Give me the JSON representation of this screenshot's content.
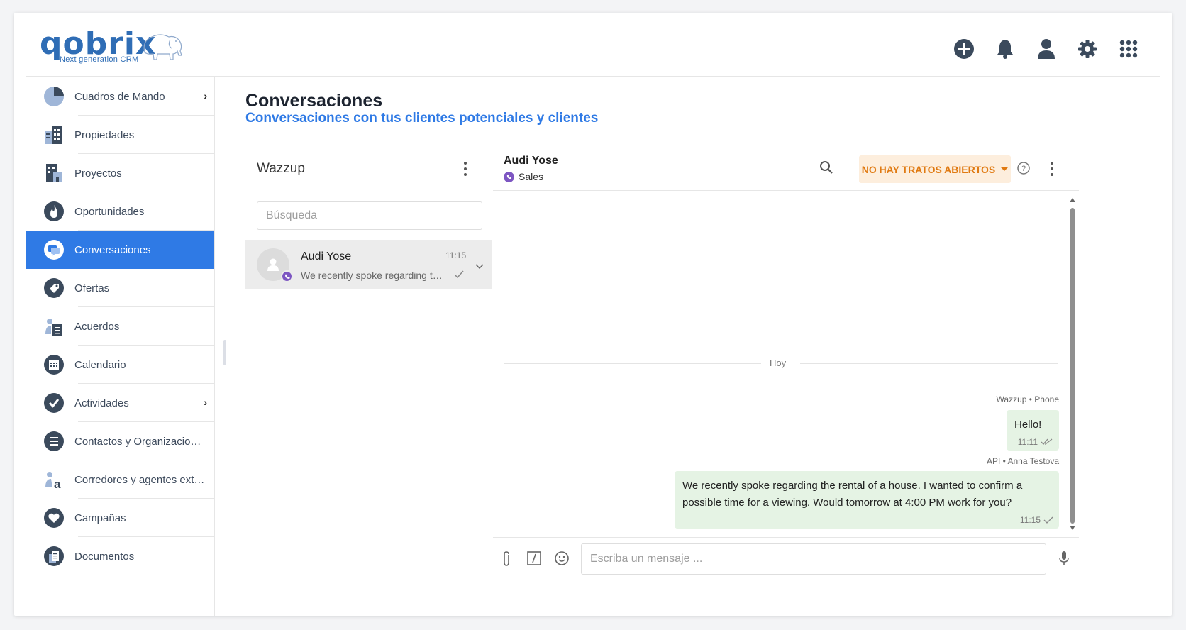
{
  "brand": {
    "name": "qobrix",
    "tagline": "Next generation CRM",
    "color": "#2f6db5"
  },
  "topbar": {
    "icons": [
      "add-circle-icon",
      "bell-icon",
      "user-icon",
      "gear-icon",
      "apps-grid-icon"
    ]
  },
  "sidebar": {
    "items": [
      {
        "label": "Cuadros de Mando",
        "icon": "pie-chart-icon",
        "has_submenu": true
      },
      {
        "label": "Propiedades",
        "icon": "building-icon"
      },
      {
        "label": "Proyectos",
        "icon": "project-building-icon"
      },
      {
        "label": "Oportunidades",
        "icon": "flame-icon"
      },
      {
        "label": "Conversaciones",
        "icon": "chat-icon",
        "active": true
      },
      {
        "label": "Ofertas",
        "icon": "tag-icon"
      },
      {
        "label": "Acuerdos",
        "icon": "agreement-icon"
      },
      {
        "label": "Calendario",
        "icon": "calendar-icon"
      },
      {
        "label": "Actividades",
        "icon": "check-circle-icon",
        "has_submenu": true
      },
      {
        "label": "Contactos y Organizaciones",
        "icon": "contacts-icon"
      },
      {
        "label": "Corredores y agentes exte…",
        "icon": "agents-icon"
      },
      {
        "label": "Campañas",
        "icon": "heart-icon"
      },
      {
        "label": "Documentos",
        "icon": "documents-icon"
      }
    ],
    "active_color": "#2f7ae5"
  },
  "page": {
    "title": "Conversaciones",
    "subtitle": "Conversaciones con tus clientes potenciales y clientes"
  },
  "conversation_list": {
    "title": "Wazzup",
    "search_placeholder": "Búsqueda",
    "items": [
      {
        "name": "Audi Yose",
        "time": "11:15",
        "preview": "We recently spoke regarding th…",
        "channel_icon": "viber-icon"
      }
    ]
  },
  "chat": {
    "contact_name": "Audi Yose",
    "channel": "Sales",
    "deals_button": "NO HAY TRATOS ABIERTOS",
    "day_separator": "Hoy",
    "messages": [
      {
        "meta": "Wazzup • Phone",
        "text": "Hello!",
        "time": "11:11",
        "status": "read"
      },
      {
        "meta": "API • Anna Testova",
        "text": "We recently spoke regarding the rental of a house. I wanted to confirm a possible time for a viewing. Would tomorrow at 4:00 PM work for you?",
        "time": "11:15",
        "status": "sent"
      }
    ],
    "composer_placeholder": "Escriba un mensaje ...",
    "bubble_color": "#e5f3e4",
    "deals_color": "#e07a12"
  }
}
